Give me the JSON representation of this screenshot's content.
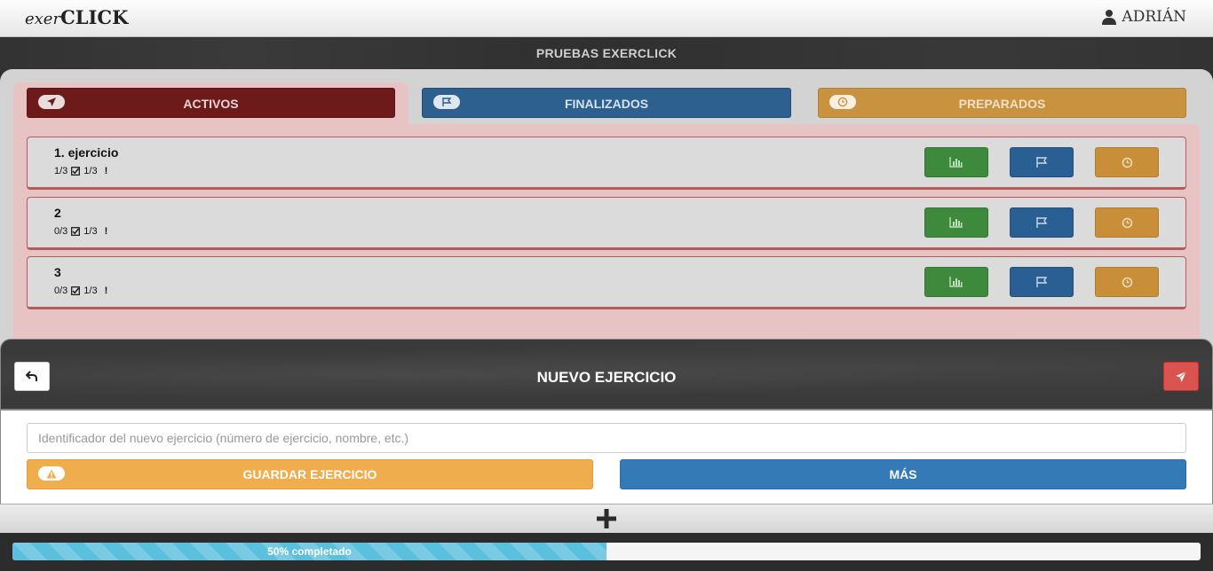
{
  "app": {
    "logo_part1": "exer",
    "logo_part2": "CLICK",
    "user_name": "ADRIÁN"
  },
  "page": {
    "header": "PRUEBAS EXERCLICK"
  },
  "tabs": [
    {
      "label": "ACTIVOS",
      "icon": "paper-plane-icon"
    },
    {
      "label": "FINALIZADOS",
      "icon": "flag-icon"
    },
    {
      "label": "PREPARADOS",
      "icon": "clock-icon"
    }
  ],
  "exercises": [
    {
      "title": "1. ejercicio",
      "done": "1/3",
      "alerts": "1/3"
    },
    {
      "title": "2",
      "done": "0/3",
      "alerts": "1/3"
    },
    {
      "title": "3",
      "done": "0/3",
      "alerts": "1/3"
    }
  ],
  "row_actions": [
    "chart-icon",
    "flag-icon",
    "clock-icon"
  ],
  "new_exercise": {
    "title": "NUEVO EJERCICIO",
    "placeholder": "Identificador del nuevo ejercicio (número de ejercicio, nombre, etc.)",
    "save_label": "GUARDAR EJERCICIO",
    "more_label": "MÁS"
  },
  "progress": {
    "percent": 50,
    "label": "50% completado"
  },
  "colors": {
    "activos": "#6e1a1a",
    "finalizados": "#2d5f8f",
    "preparados": "#c8923f",
    "warning": "#f0ad4e",
    "primary": "#337ab7",
    "danger": "#d9534f",
    "progress": "#5bc0de"
  }
}
